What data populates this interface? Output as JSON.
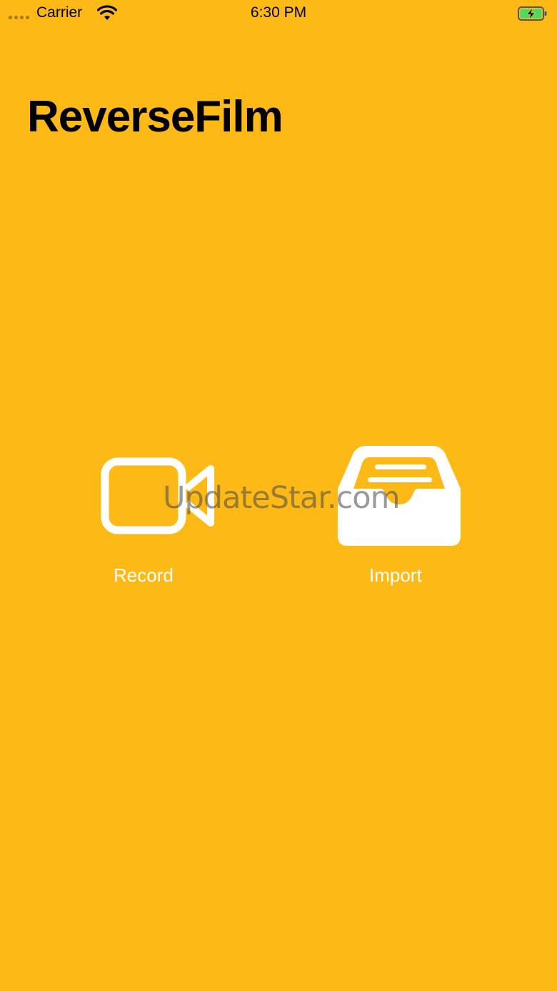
{
  "status_bar": {
    "carrier": "Carrier",
    "time": "6:30 PM",
    "wifi_icon": "wifi-icon",
    "battery_icon": "battery-charging-icon"
  },
  "app": {
    "title": "ReverseFilm",
    "background_color": "#FDBA17"
  },
  "actions": {
    "record": {
      "label": "Record",
      "icon": "video-camera-icon"
    },
    "import": {
      "label": "Import",
      "icon": "tray-icon"
    }
  },
  "watermark": {
    "text": "UpdateStar.com"
  }
}
